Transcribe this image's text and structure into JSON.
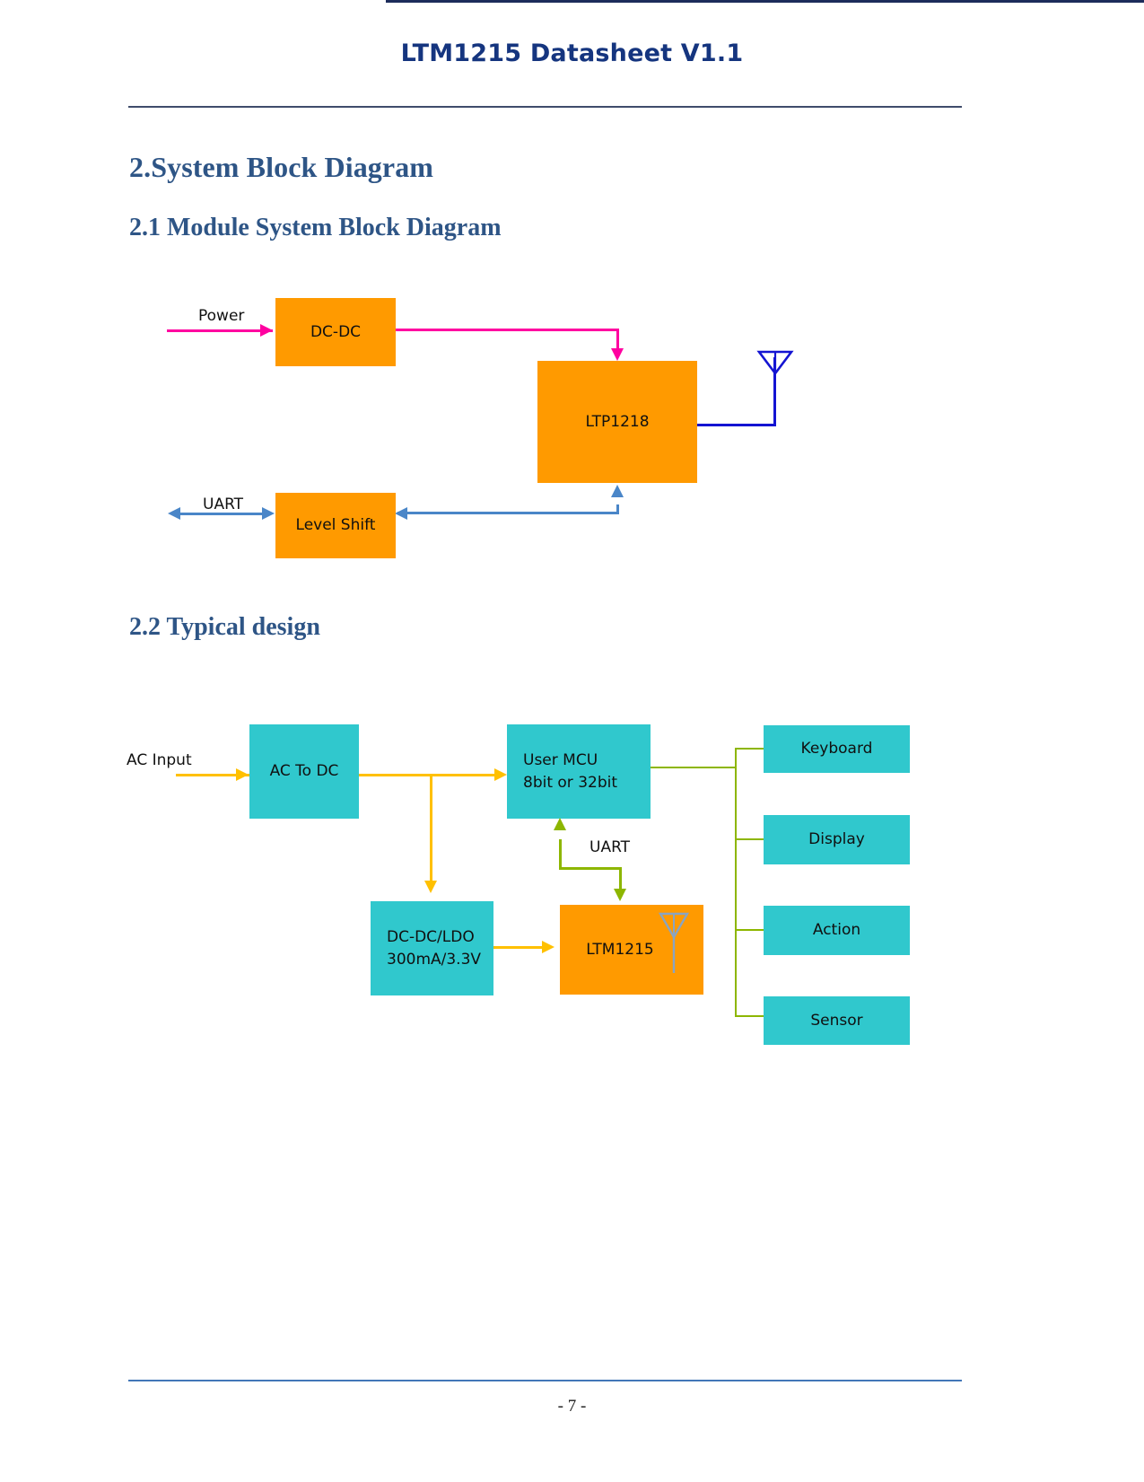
{
  "document": {
    "header_title": "LTM1215 Datasheet V1.1",
    "page_number": "- 7 -"
  },
  "headings": {
    "section2": "2.System Block Diagram",
    "section2_1": "2.1 Module System Block Diagram",
    "section2_2": "2.2 Typical design"
  },
  "colors": {
    "heading_blue": "#2e5586",
    "header_navy": "#15357f",
    "block_orange": "#ff9a00",
    "block_teal": "#30c8cd",
    "arrow_magenta": "#ff00a0",
    "arrow_blue": "#4a86c8",
    "arrow_yellow": "#ffc000",
    "arrow_olive": "#8db600",
    "antenna_blue": "#1414d2",
    "antenna_gray": "#8aa4c0",
    "footer_rule": "#4277b8"
  },
  "module_diagram": {
    "title": "2.1 Module System Block Diagram",
    "blocks": [
      {
        "id": "dcdc",
        "label": "DC-DC",
        "color": "orange"
      },
      {
        "id": "ltp1218",
        "label": "LTP1218",
        "color": "orange"
      },
      {
        "id": "lvlshift",
        "label": "Level Shift",
        "color": "orange"
      }
    ],
    "labels": {
      "power": "Power",
      "uart": "UART"
    },
    "icons": {
      "antenna": "antenna-icon"
    },
    "connections": [
      {
        "from": "Power",
        "to": "DC-DC",
        "color": "magenta",
        "style": "arrow"
      },
      {
        "from": "DC-DC",
        "to": "LTP1218",
        "color": "magenta",
        "style": "arrow"
      },
      {
        "from": "LTP1218",
        "to": "Antenna",
        "color": "blue",
        "style": "line"
      },
      {
        "from": "LTP1218",
        "to": "Level Shift",
        "color": "blue",
        "style": "arrow"
      },
      {
        "from": "Level Shift",
        "to": "LTP1218",
        "color": "blue",
        "style": "arrow"
      },
      {
        "from": "UART",
        "to": "Level Shift",
        "color": "blue",
        "style": "double-arrow"
      }
    ]
  },
  "typical_design": {
    "title": "2.2 Typical design",
    "input_label": "AC Input",
    "uart_label": "UART",
    "blocks": [
      {
        "id": "ac2dc",
        "lines": [
          "AC To DC"
        ],
        "color": "teal"
      },
      {
        "id": "usermcu",
        "lines": [
          "User MCU",
          "8bit or 32bit"
        ],
        "color": "teal"
      },
      {
        "id": "dcdcldo",
        "lines": [
          "DC-DC/LDO",
          "300mA/3.3V"
        ],
        "color": "teal"
      },
      {
        "id": "ltm1215",
        "lines": [
          "LTM1215"
        ],
        "color": "orange"
      }
    ],
    "peripherals": [
      {
        "id": "keyboard",
        "label": "Keyboard",
        "color": "teal"
      },
      {
        "id": "display",
        "label": "Display",
        "color": "teal"
      },
      {
        "id": "action",
        "label": "Action",
        "color": "teal"
      },
      {
        "id": "sensor",
        "label": "Sensor",
        "color": "teal"
      }
    ],
    "icons": {
      "antenna": "antenna-icon"
    },
    "connections": [
      {
        "from": "AC Input",
        "to": "AC To DC",
        "color": "yellow",
        "style": "arrow"
      },
      {
        "from": "AC To DC",
        "to": "User MCU",
        "color": "yellow",
        "style": "arrow"
      },
      {
        "from": "AC To DC",
        "to": "DC-DC/LDO",
        "color": "yellow",
        "style": "arrow"
      },
      {
        "from": "DC-DC/LDO",
        "to": "LTM1215",
        "color": "yellow",
        "style": "arrow"
      },
      {
        "from": "LTM1215",
        "to": "User MCU",
        "color": "olive",
        "style": "arrow",
        "label": "UART"
      },
      {
        "from": "User MCU",
        "to": "LTM1215",
        "color": "olive",
        "style": "arrow",
        "label": "UART"
      },
      {
        "from": "User MCU",
        "to": "Keyboard",
        "color": "olive",
        "style": "bus"
      },
      {
        "from": "User MCU",
        "to": "Display",
        "color": "olive",
        "style": "bus"
      },
      {
        "from": "User MCU",
        "to": "Action",
        "color": "olive",
        "style": "bus"
      },
      {
        "from": "User MCU",
        "to": "Sensor",
        "color": "olive",
        "style": "bus"
      }
    ]
  }
}
